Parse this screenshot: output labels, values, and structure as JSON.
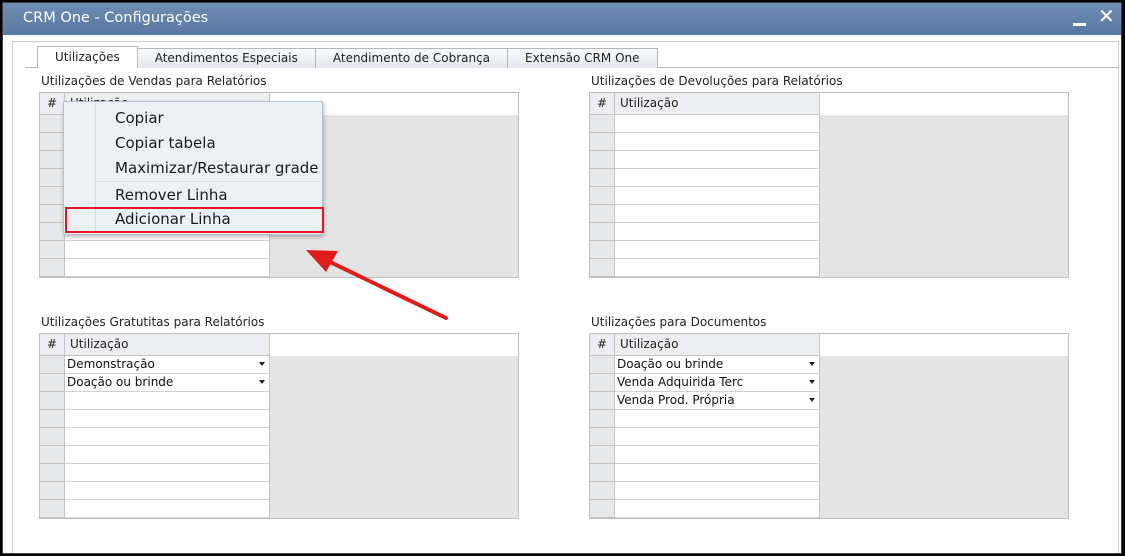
{
  "window": {
    "title": "CRM One - Configurações"
  },
  "tabs": [
    {
      "label": "Utilizações"
    },
    {
      "label": "Atendimentos Especiais"
    },
    {
      "label": "Atendimento de Cobrança"
    },
    {
      "label": "Extensão CRM One"
    }
  ],
  "grids": {
    "vendas": {
      "title": "Utilizações de Vendas para Relatórios",
      "num_header": "#",
      "col_header": "Utilização",
      "rows": [
        "",
        "",
        "",
        "",
        "",
        "",
        "",
        "",
        ""
      ]
    },
    "devolucoes": {
      "title": "Utilizações de Devoluções para Relatórios",
      "num_header": "#",
      "col_header": "Utilização",
      "rows": [
        "",
        "",
        "",
        "",
        "",
        "",
        "",
        "",
        ""
      ]
    },
    "gratuitas": {
      "title": "Utilizações Gratutitas para Relatórios",
      "num_header": "#",
      "col_header": "Utilização",
      "rows": [
        "Demonstração",
        "Doação ou brinde",
        "",
        "",
        "",
        "",
        "",
        "",
        ""
      ],
      "dropdown_rows": 2
    },
    "documentos": {
      "title": "Utilizações para Documentos",
      "num_header": "#",
      "col_header": "Utilização",
      "rows": [
        "Doação ou brinde",
        "Venda Adquirida Terc",
        "Venda Prod. Própria",
        "",
        "",
        "",
        "",
        "",
        ""
      ],
      "dropdown_rows": 3
    }
  },
  "context_menu": {
    "items": [
      {
        "label": "Copiar"
      },
      {
        "label": "Copiar tabela"
      },
      {
        "label": "Maximizar/Restaurar grade"
      },
      {
        "label": "Remover Linha"
      },
      {
        "label": "Adicionar Linha"
      }
    ],
    "highlighted_item": "Adicionar Linha"
  },
  "annotation": {
    "color": "#e01b1b"
  }
}
